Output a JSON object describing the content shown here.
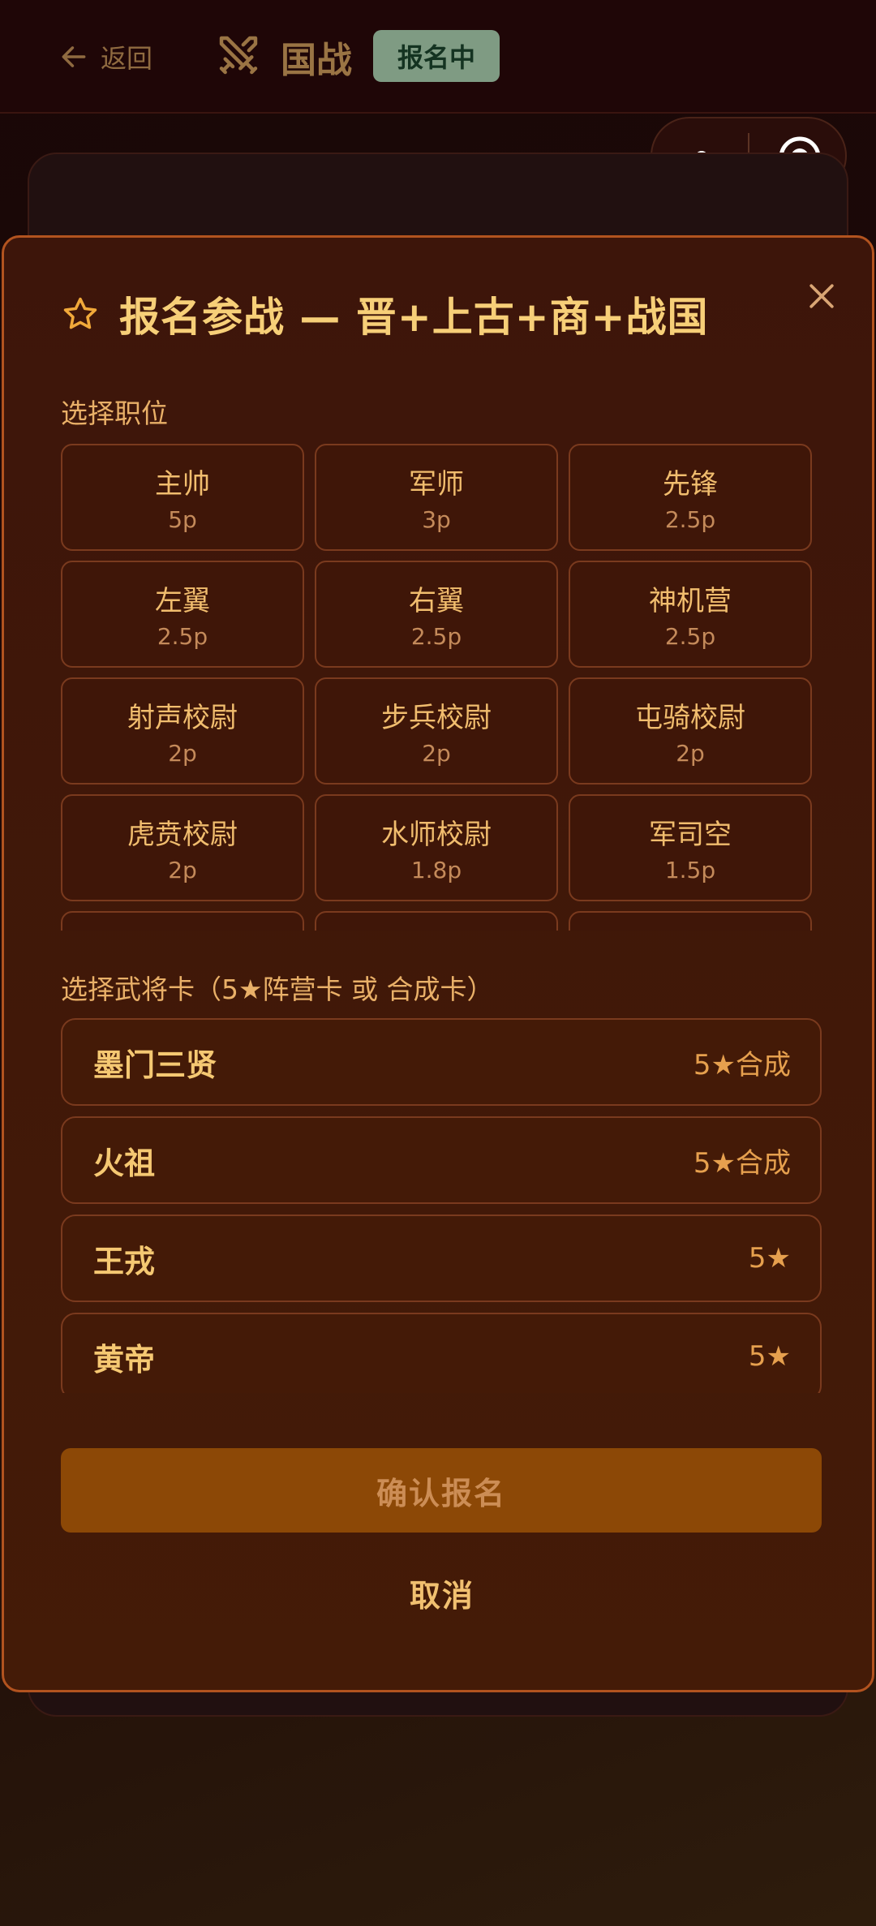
{
  "header": {
    "back_label": "返回",
    "title": "国战",
    "status_badge": "报名中"
  },
  "modal": {
    "title": "报名参战 — 晋+上古+商+战国",
    "positions_label": "选择职位",
    "positions": [
      {
        "name": "主帅",
        "points": "5p"
      },
      {
        "name": "军师",
        "points": "3p"
      },
      {
        "name": "先锋",
        "points": "2.5p"
      },
      {
        "name": "左翼",
        "points": "2.5p"
      },
      {
        "name": "右翼",
        "points": "2.5p"
      },
      {
        "name": "神机营",
        "points": "2.5p"
      },
      {
        "name": "射声校尉",
        "points": "2p"
      },
      {
        "name": "步兵校尉",
        "points": "2p"
      },
      {
        "name": "屯骑校尉",
        "points": "2p"
      },
      {
        "name": "虎贲校尉",
        "points": "2p"
      },
      {
        "name": "水师校尉",
        "points": "1.8p"
      },
      {
        "name": "军司空",
        "points": "1.5p"
      },
      {
        "name": "",
        "points": ""
      },
      {
        "name": "",
        "points": ""
      },
      {
        "name": "",
        "points": ""
      }
    ],
    "cards_label": "选择武将卡（5★阵营卡 或 合成卡）",
    "cards": [
      {
        "name": "墨门三贤",
        "tag": "5★合成"
      },
      {
        "name": "火祖",
        "tag": "5★合成"
      },
      {
        "name": "王戎",
        "tag": "5★"
      },
      {
        "name": "黄帝",
        "tag": "5★"
      }
    ],
    "confirm_label": "确认报名",
    "cancel_label": "取消"
  },
  "icons": {
    "back": "arrow-left-icon",
    "title": "crossed-swords-icon",
    "star": "star-outline-icon",
    "close": "close-icon",
    "more": "more-dots-icon",
    "target": "target-icon"
  },
  "colors": {
    "accent": "#f5c068",
    "modal_border": "#b2531f",
    "confirm_bg": "#8c4806",
    "badge_bg": "#7f9b83"
  }
}
